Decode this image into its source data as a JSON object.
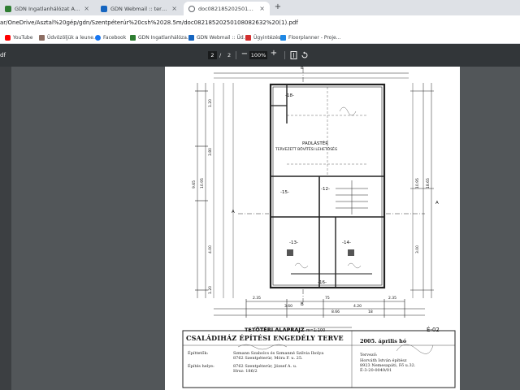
{
  "tabs": [
    {
      "title": "GDN Ingatlanhálózat Admin fe",
      "favicon_color": "#2e7d32"
    },
    {
      "title": "GDN Webmail :: tervrajz",
      "favicon_color": "#1565c0"
    },
    {
      "title": "doc08218520250108082632.pdf",
      "favicon_color": "#5f6368"
    }
  ],
  "new_tab_glyph": "+",
  "address": {
    "url": "ar/OneDrive/Asztal%20gép/gdn/Szentpéterúr%20csh%2028.5m/doc08218520250108082632%20(1).pdf"
  },
  "bookmarks": [
    {
      "label": "YouTube",
      "color": "#ff0000"
    },
    {
      "label": "Üdvözöljük a leune...",
      "color": "#8d6e63"
    },
    {
      "label": "Facebook",
      "color": "#1877f2"
    },
    {
      "label": "GDN Ingatlanhálóza...",
      "color": "#2e7d32"
    },
    {
      "label": "GDN Webmail :: Üd...",
      "color": "#1565c0"
    },
    {
      "label": "Ügyintézés",
      "color": "#d32f2f"
    },
    {
      "label": "Floorplanner - Proje...",
      "color": "#1e88e5"
    }
  ],
  "pdf_toolbar": {
    "file_label": "df",
    "current_page": "2",
    "page_separator": "/",
    "total_pages": "2",
    "zoom": "100%",
    "zoom_out": "−",
    "zoom_in": "+"
  },
  "drawing": {
    "room_attic": "PADLÁSTÉR",
    "room_attic_note": "TERVEZETT BŐVÍTÉSI LEHETŐSÉG",
    "rooms": [
      "-18-",
      "-15-",
      "-12-",
      "-13-",
      "-14-",
      "-16-"
    ],
    "section_a": "A",
    "section_b": "B",
    "dims_bottom": [
      "2.35",
      "3.60",
      "75",
      "8.66",
      "4.20",
      "2.35",
      "18"
    ],
    "dims_left": [
      "9.65",
      "10.95",
      "1.20",
      "3.80",
      "4.00",
      "1.20"
    ],
    "dims_right": [
      "10.95",
      "3.00",
      "18.65"
    ],
    "plan_title": "TETŐTÉRI ALAPRAJZ",
    "plan_scale": "m=1:100",
    "sheet_code": "É-02"
  },
  "title_block": {
    "title": "CSALÁDIHÁZ ÉPÍTÉSI ENGEDÉLY TERVE",
    "date": "2005. április hó",
    "builder_label": "Építtetők:",
    "builder_value": [
      "Szmann Szabolcs és Szmanné Szilvia Ibolya",
      "8762 Szentpéterúr, Móra F. u. 25."
    ],
    "site_label": "Építés helye:",
    "site_value": [
      "8762 Szentpéterúr, József A. u.",
      "Hrsz: 186/2"
    ],
    "designer_label": "Tervező:",
    "designer_value": [
      "Horváth István építész",
      "8923 Nemesapáti, Fő u.32.",
      "É-3-20-0049/01"
    ]
  }
}
